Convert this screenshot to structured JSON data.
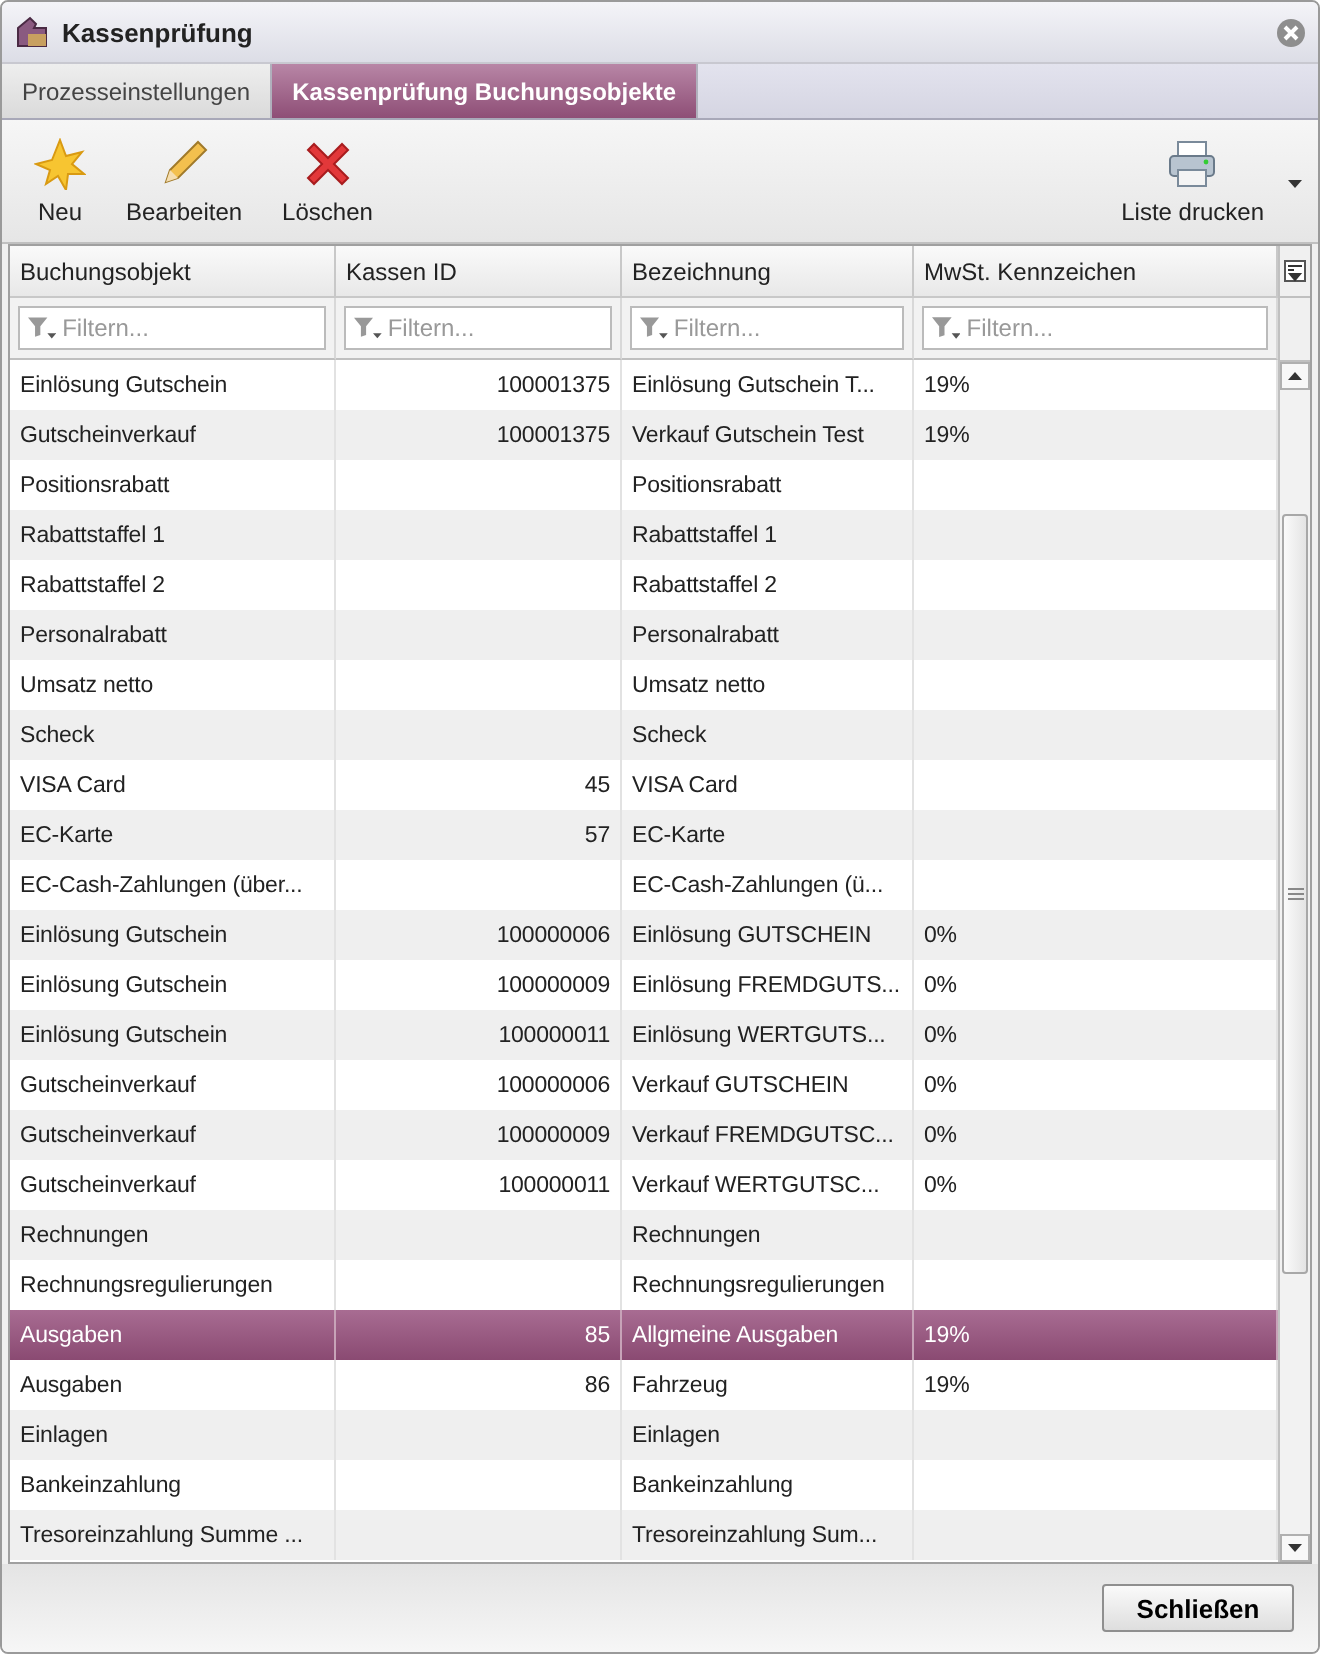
{
  "window": {
    "title": "Kassenprüfung"
  },
  "tabs": [
    {
      "label": "Prozesseinstellungen",
      "selected": false
    },
    {
      "label": "Kassenprüfung Buchungsobjekte",
      "selected": true
    }
  ],
  "toolbar": [
    {
      "kind": "new",
      "label": "Neu"
    },
    {
      "kind": "edit",
      "label": "Bearbeiten"
    },
    {
      "kind": "delete",
      "label": "Löschen"
    },
    {
      "kind": "print",
      "label": "Liste drucken"
    }
  ],
  "table": {
    "columns": [
      {
        "label": "Buchungsobjekt",
        "filter_placeholder": "Filtern...",
        "kind": "text"
      },
      {
        "label": "Kassen ID",
        "filter_placeholder": "Filtern...",
        "kind": "number"
      },
      {
        "label": "Bezeichnung",
        "filter_placeholder": "Filtern...",
        "kind": "text"
      },
      {
        "label": "MwSt. Kennzeichen",
        "filter_placeholder": "Filtern...",
        "kind": "text"
      }
    ],
    "rows": [
      {
        "cells": [
          "Einlösung Gutschein",
          "100001375",
          "Einlösung Gutschein T...",
          "19%"
        ],
        "selected": false
      },
      {
        "cells": [
          "Gutscheinverkauf",
          "100001375",
          "Verkauf Gutschein Test",
          "19%"
        ],
        "selected": false
      },
      {
        "cells": [
          "Positionsrabatt",
          "",
          "Positionsrabatt",
          ""
        ],
        "selected": false
      },
      {
        "cells": [
          "Rabattstaffel 1",
          "",
          "Rabattstaffel 1",
          ""
        ],
        "selected": false
      },
      {
        "cells": [
          "Rabattstaffel 2",
          "",
          "Rabattstaffel 2",
          ""
        ],
        "selected": false
      },
      {
        "cells": [
          "Personalrabatt",
          "",
          "Personalrabatt",
          ""
        ],
        "selected": false
      },
      {
        "cells": [
          "Umsatz netto",
          "",
          "Umsatz netto",
          ""
        ],
        "selected": false
      },
      {
        "cells": [
          "Scheck",
          "",
          "Scheck",
          ""
        ],
        "selected": false
      },
      {
        "cells": [
          "VISA Card",
          "45",
          "VISA Card",
          ""
        ],
        "selected": false
      },
      {
        "cells": [
          "EC-Karte",
          "57",
          "EC-Karte",
          ""
        ],
        "selected": false
      },
      {
        "cells": [
          "EC-Cash-Zahlungen (über...",
          "",
          "EC-Cash-Zahlungen (ü...",
          ""
        ],
        "selected": false
      },
      {
        "cells": [
          "Einlösung Gutschein",
          "100000006",
          "Einlösung GUTSCHEIN",
          "0%"
        ],
        "selected": false
      },
      {
        "cells": [
          "Einlösung Gutschein",
          "100000009",
          "Einlösung FREMDGUTS...",
          "0%"
        ],
        "selected": false
      },
      {
        "cells": [
          "Einlösung Gutschein",
          "100000011",
          "Einlösung WERTGUTS...",
          "0%"
        ],
        "selected": false
      },
      {
        "cells": [
          "Gutscheinverkauf",
          "100000006",
          "Verkauf GUTSCHEIN",
          "0%"
        ],
        "selected": false
      },
      {
        "cells": [
          "Gutscheinverkauf",
          "100000009",
          "Verkauf FREMDGUTSC...",
          "0%"
        ],
        "selected": false
      },
      {
        "cells": [
          "Gutscheinverkauf",
          "100000011",
          "Verkauf WERTGUTSC...",
          "0%"
        ],
        "selected": false
      },
      {
        "cells": [
          "Rechnungen",
          "",
          "Rechnungen",
          ""
        ],
        "selected": false
      },
      {
        "cells": [
          "Rechnungsregulierungen",
          "",
          "Rechnungsregulierungen",
          ""
        ],
        "selected": false
      },
      {
        "cells": [
          "Ausgaben",
          "85",
          "Allgmeine Ausgaben",
          "19%"
        ],
        "selected": true
      },
      {
        "cells": [
          "Ausgaben",
          "86",
          "Fahrzeug",
          "19%"
        ],
        "selected": false
      },
      {
        "cells": [
          "Einlagen",
          "",
          "Einlagen",
          ""
        ],
        "selected": false
      },
      {
        "cells": [
          "Bankeinzahlung",
          "",
          "Bankeinzahlung",
          ""
        ],
        "selected": false
      },
      {
        "cells": [
          "Tresoreinzahlung Summe ...",
          "",
          "Tresoreinzahlung Sum...",
          ""
        ],
        "selected": false
      }
    ]
  },
  "buttons": [
    {
      "label": "Schließen"
    }
  ]
}
